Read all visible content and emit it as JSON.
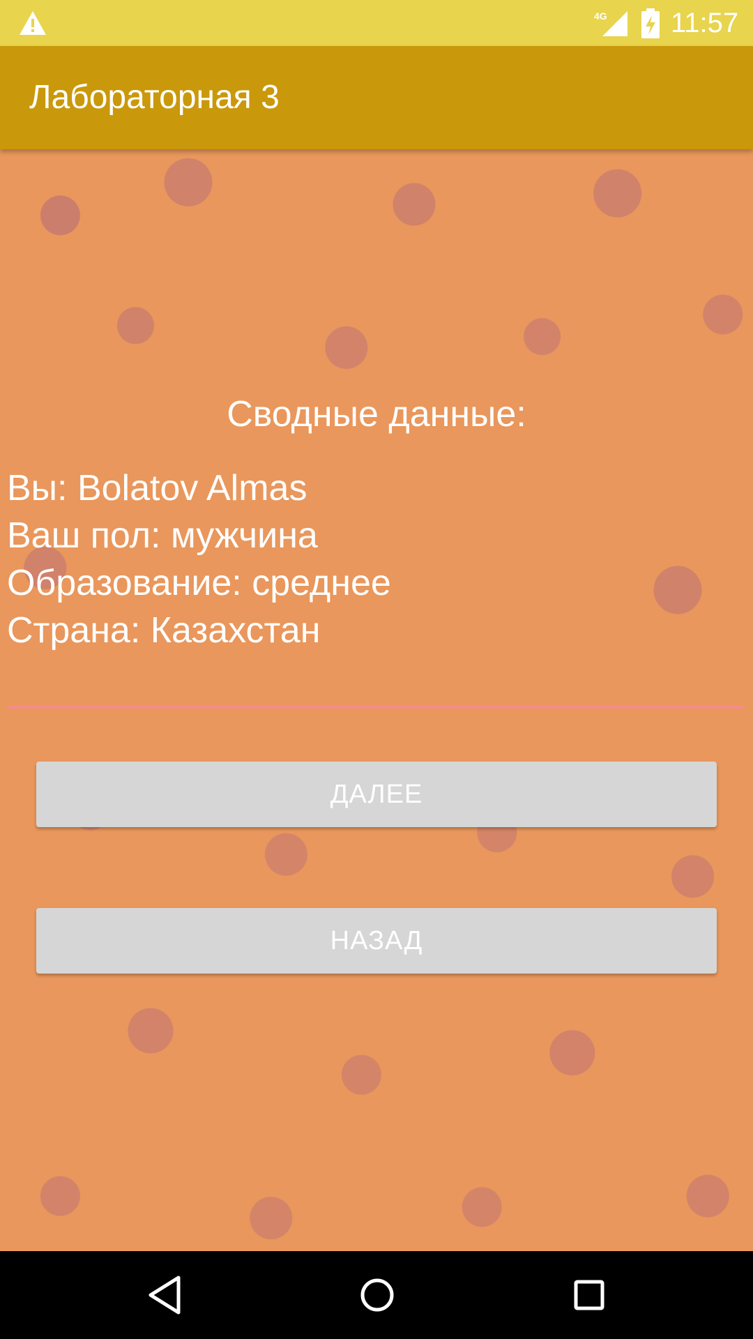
{
  "status_bar": {
    "time": "11:57",
    "network_label": "4G",
    "icons": [
      "warning-icon",
      "signal-icon",
      "battery-charging-icon"
    ]
  },
  "app_bar": {
    "title": "Лабораторная 3"
  },
  "summary": {
    "heading": "Сводные данные:",
    "lines": [
      "Вы: Bolatov Almas",
      "Ваш пол: мужчина",
      "Образование: среднее",
      "Страна: Казахстан"
    ]
  },
  "buttons": {
    "next_label": "ДАЛЕЕ",
    "back_label": "НАЗАД"
  },
  "nav_bar": {
    "icons": [
      "back-icon",
      "home-icon",
      "recents-icon"
    ]
  },
  "colors": {
    "status_bar": "#E8D44D",
    "app_bar": "#CA980B",
    "background": "#E9975C",
    "button": "#D6D6D6",
    "divider": "#F58C8C"
  }
}
